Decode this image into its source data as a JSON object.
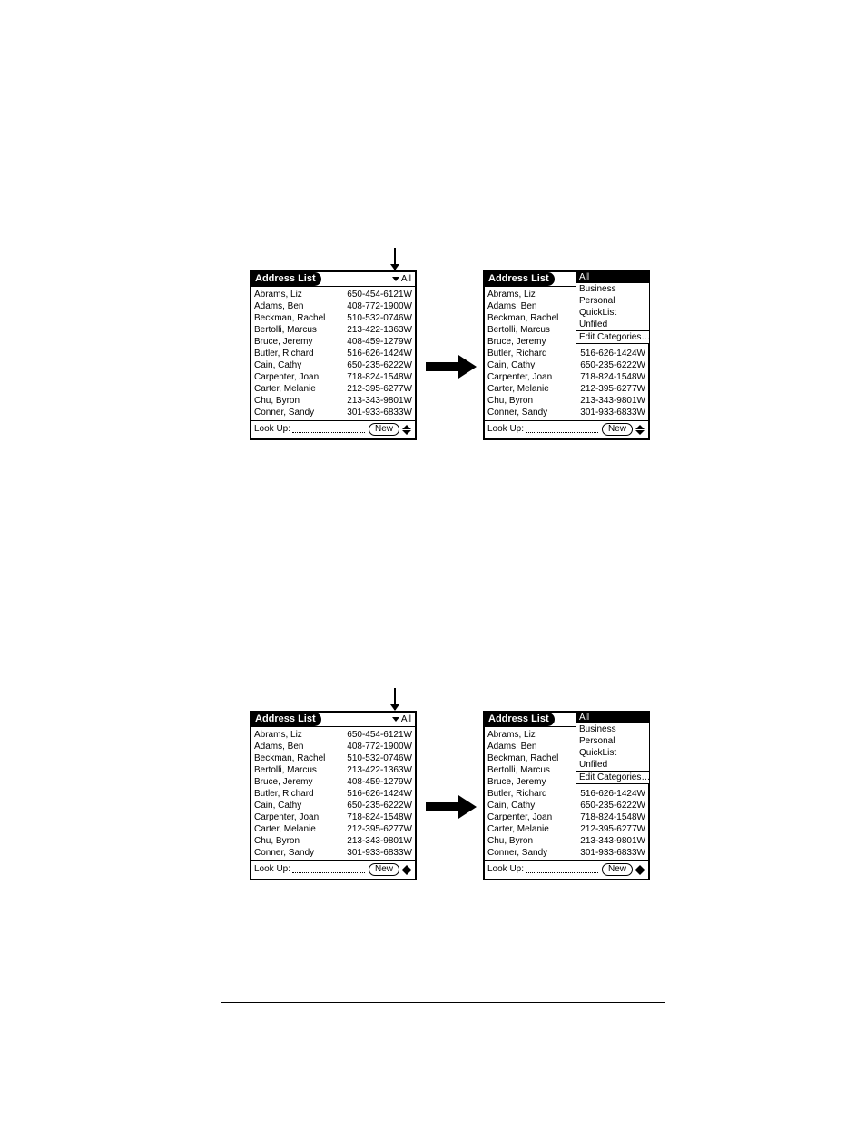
{
  "address_list": {
    "title": "Address List",
    "category_trigger": "All",
    "lookup_label": "Look Up:",
    "new_button": "New",
    "entries": [
      {
        "name": "Abrams, Liz",
        "phone": "650-454-6121W"
      },
      {
        "name": "Adams, Ben",
        "phone": "408-772-1900W"
      },
      {
        "name": "Beckman, Rachel",
        "phone": "510-532-0746W"
      },
      {
        "name": "Bertolli, Marcus",
        "phone": "213-422-1363W"
      },
      {
        "name": "Bruce, Jeremy",
        "phone": "408-459-1279W"
      },
      {
        "name": "Butler, Richard",
        "phone": "516-626-1424W"
      },
      {
        "name": "Cain, Cathy",
        "phone": "650-235-6222W"
      },
      {
        "name": "Carpenter, Joan",
        "phone": "718-824-1548W"
      },
      {
        "name": "Carter, Melanie",
        "phone": "212-395-6277W"
      },
      {
        "name": "Chu, Byron",
        "phone": "213-343-9801W"
      },
      {
        "name": "Conner, Sandy",
        "phone": "301-933-6833W"
      }
    ]
  },
  "category_popup": {
    "items": [
      "All",
      "Business",
      "Personal",
      "QuickList",
      "Unfiled",
      "Edit Categories…"
    ],
    "selected_index": 0
  }
}
